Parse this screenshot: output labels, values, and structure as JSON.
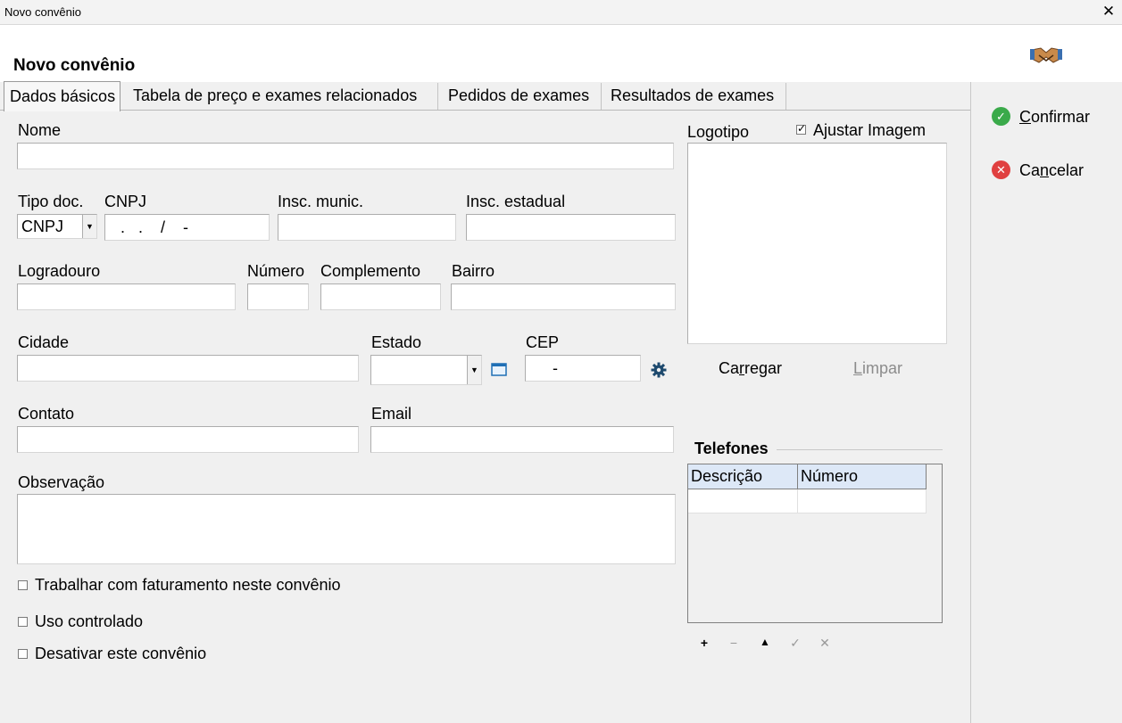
{
  "window": {
    "title": "Novo convênio",
    "close_glyph": "✕"
  },
  "header": {
    "title": "Novo convênio",
    "icon": "handshake-icon"
  },
  "tabs": [
    {
      "label": "Dados básicos",
      "active": true
    },
    {
      "label": "Tabela de preço e exames relacionados",
      "active": false
    },
    {
      "label": "Pedidos de exames",
      "active": false
    },
    {
      "label": "Resultados de exames",
      "active": false
    }
  ],
  "form": {
    "nome": {
      "label": "Nome",
      "value": ""
    },
    "tipo_doc": {
      "label": "Tipo doc.",
      "value": "CNPJ"
    },
    "cnpj": {
      "label": "CNPJ",
      "mask": " .   .    /    -"
    },
    "insc_munic": {
      "label": "Insc. munic.",
      "value": ""
    },
    "insc_estadual": {
      "label": "Insc. estadual",
      "value": ""
    },
    "logradouro": {
      "label": "Logradouro",
      "value": ""
    },
    "numero": {
      "label": "Número",
      "value": ""
    },
    "complemento": {
      "label": "Complemento",
      "value": ""
    },
    "bairro": {
      "label": "Bairro",
      "value": ""
    },
    "cidade": {
      "label": "Cidade",
      "value": ""
    },
    "estado": {
      "label": "Estado",
      "value": ""
    },
    "cep": {
      "label": "CEP",
      "mask": "  -"
    },
    "contato": {
      "label": "Contato",
      "value": ""
    },
    "email": {
      "label": "Email",
      "value": ""
    },
    "observacao": {
      "label": "Observação",
      "value": ""
    },
    "checkboxes": [
      {
        "label": "Trabalhar com faturamento neste convênio",
        "checked": false
      },
      {
        "label": "Uso controlado",
        "checked": false
      },
      {
        "label": "Desativar este convênio",
        "checked": false
      }
    ]
  },
  "logo": {
    "label": "Logotipo",
    "ajustar_label": "Ajustar Imagem",
    "ajustar_checked": true,
    "carregar_pre": "Ca",
    "carregar_u": "r",
    "carregar_post": "regar",
    "limpar_u": "L",
    "limpar_post": "impar"
  },
  "telefones": {
    "title": "Telefones",
    "columns": [
      "Descrição",
      "Número"
    ],
    "tools": [
      "+",
      "−",
      "▲",
      "✓",
      "✕"
    ]
  },
  "actions": {
    "confirmar_u": "C",
    "confirmar_post": "onfirmar",
    "cancelar_pre": "Ca",
    "cancelar_u": "n",
    "cancelar_post": "celar"
  },
  "colors": {
    "confirm": "#3aaa4a",
    "cancel": "#e04040",
    "grid_header": "#dde8f7"
  }
}
